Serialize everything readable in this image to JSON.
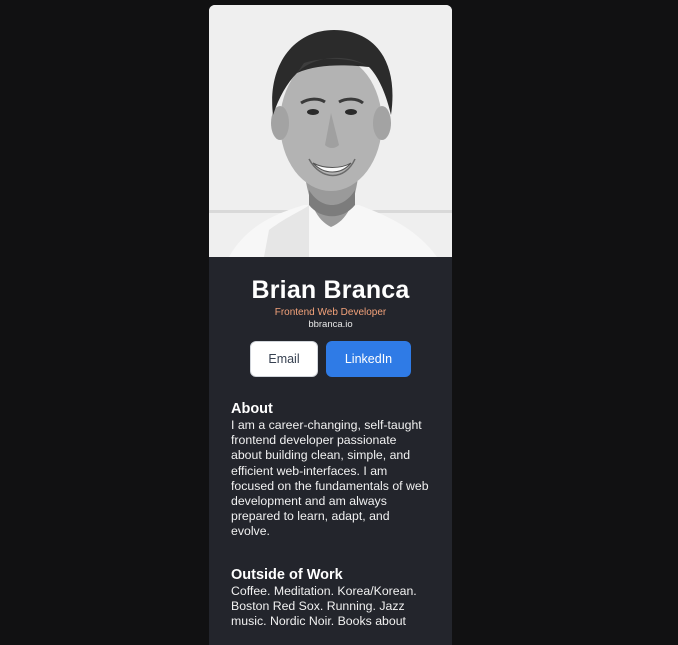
{
  "profile": {
    "name": "Brian Branca",
    "role": "Frontend Web Developer",
    "website": "bbranca.io"
  },
  "buttons": {
    "email_label": "Email",
    "linkedin_label": "LinkedIn"
  },
  "about": {
    "heading": "About",
    "body": "I am a career-changing, self-taught frontend developer passionate about building clean, simple, and efficient web-interfaces. I am focused on the fundamentals of web development and am always prepared to learn, adapt, and evolve."
  },
  "outside_work": {
    "heading": "Outside of Work",
    "body": "Coffee. Meditation. Korea/Korean. Boston Red Sox. Running. Jazz music. Nordic Noir. Books about"
  },
  "colors": {
    "page_background": "#111112",
    "card_background": "#23252c",
    "accent_role": "#f3a27a",
    "linkedin_blue": "#2f7be6"
  }
}
